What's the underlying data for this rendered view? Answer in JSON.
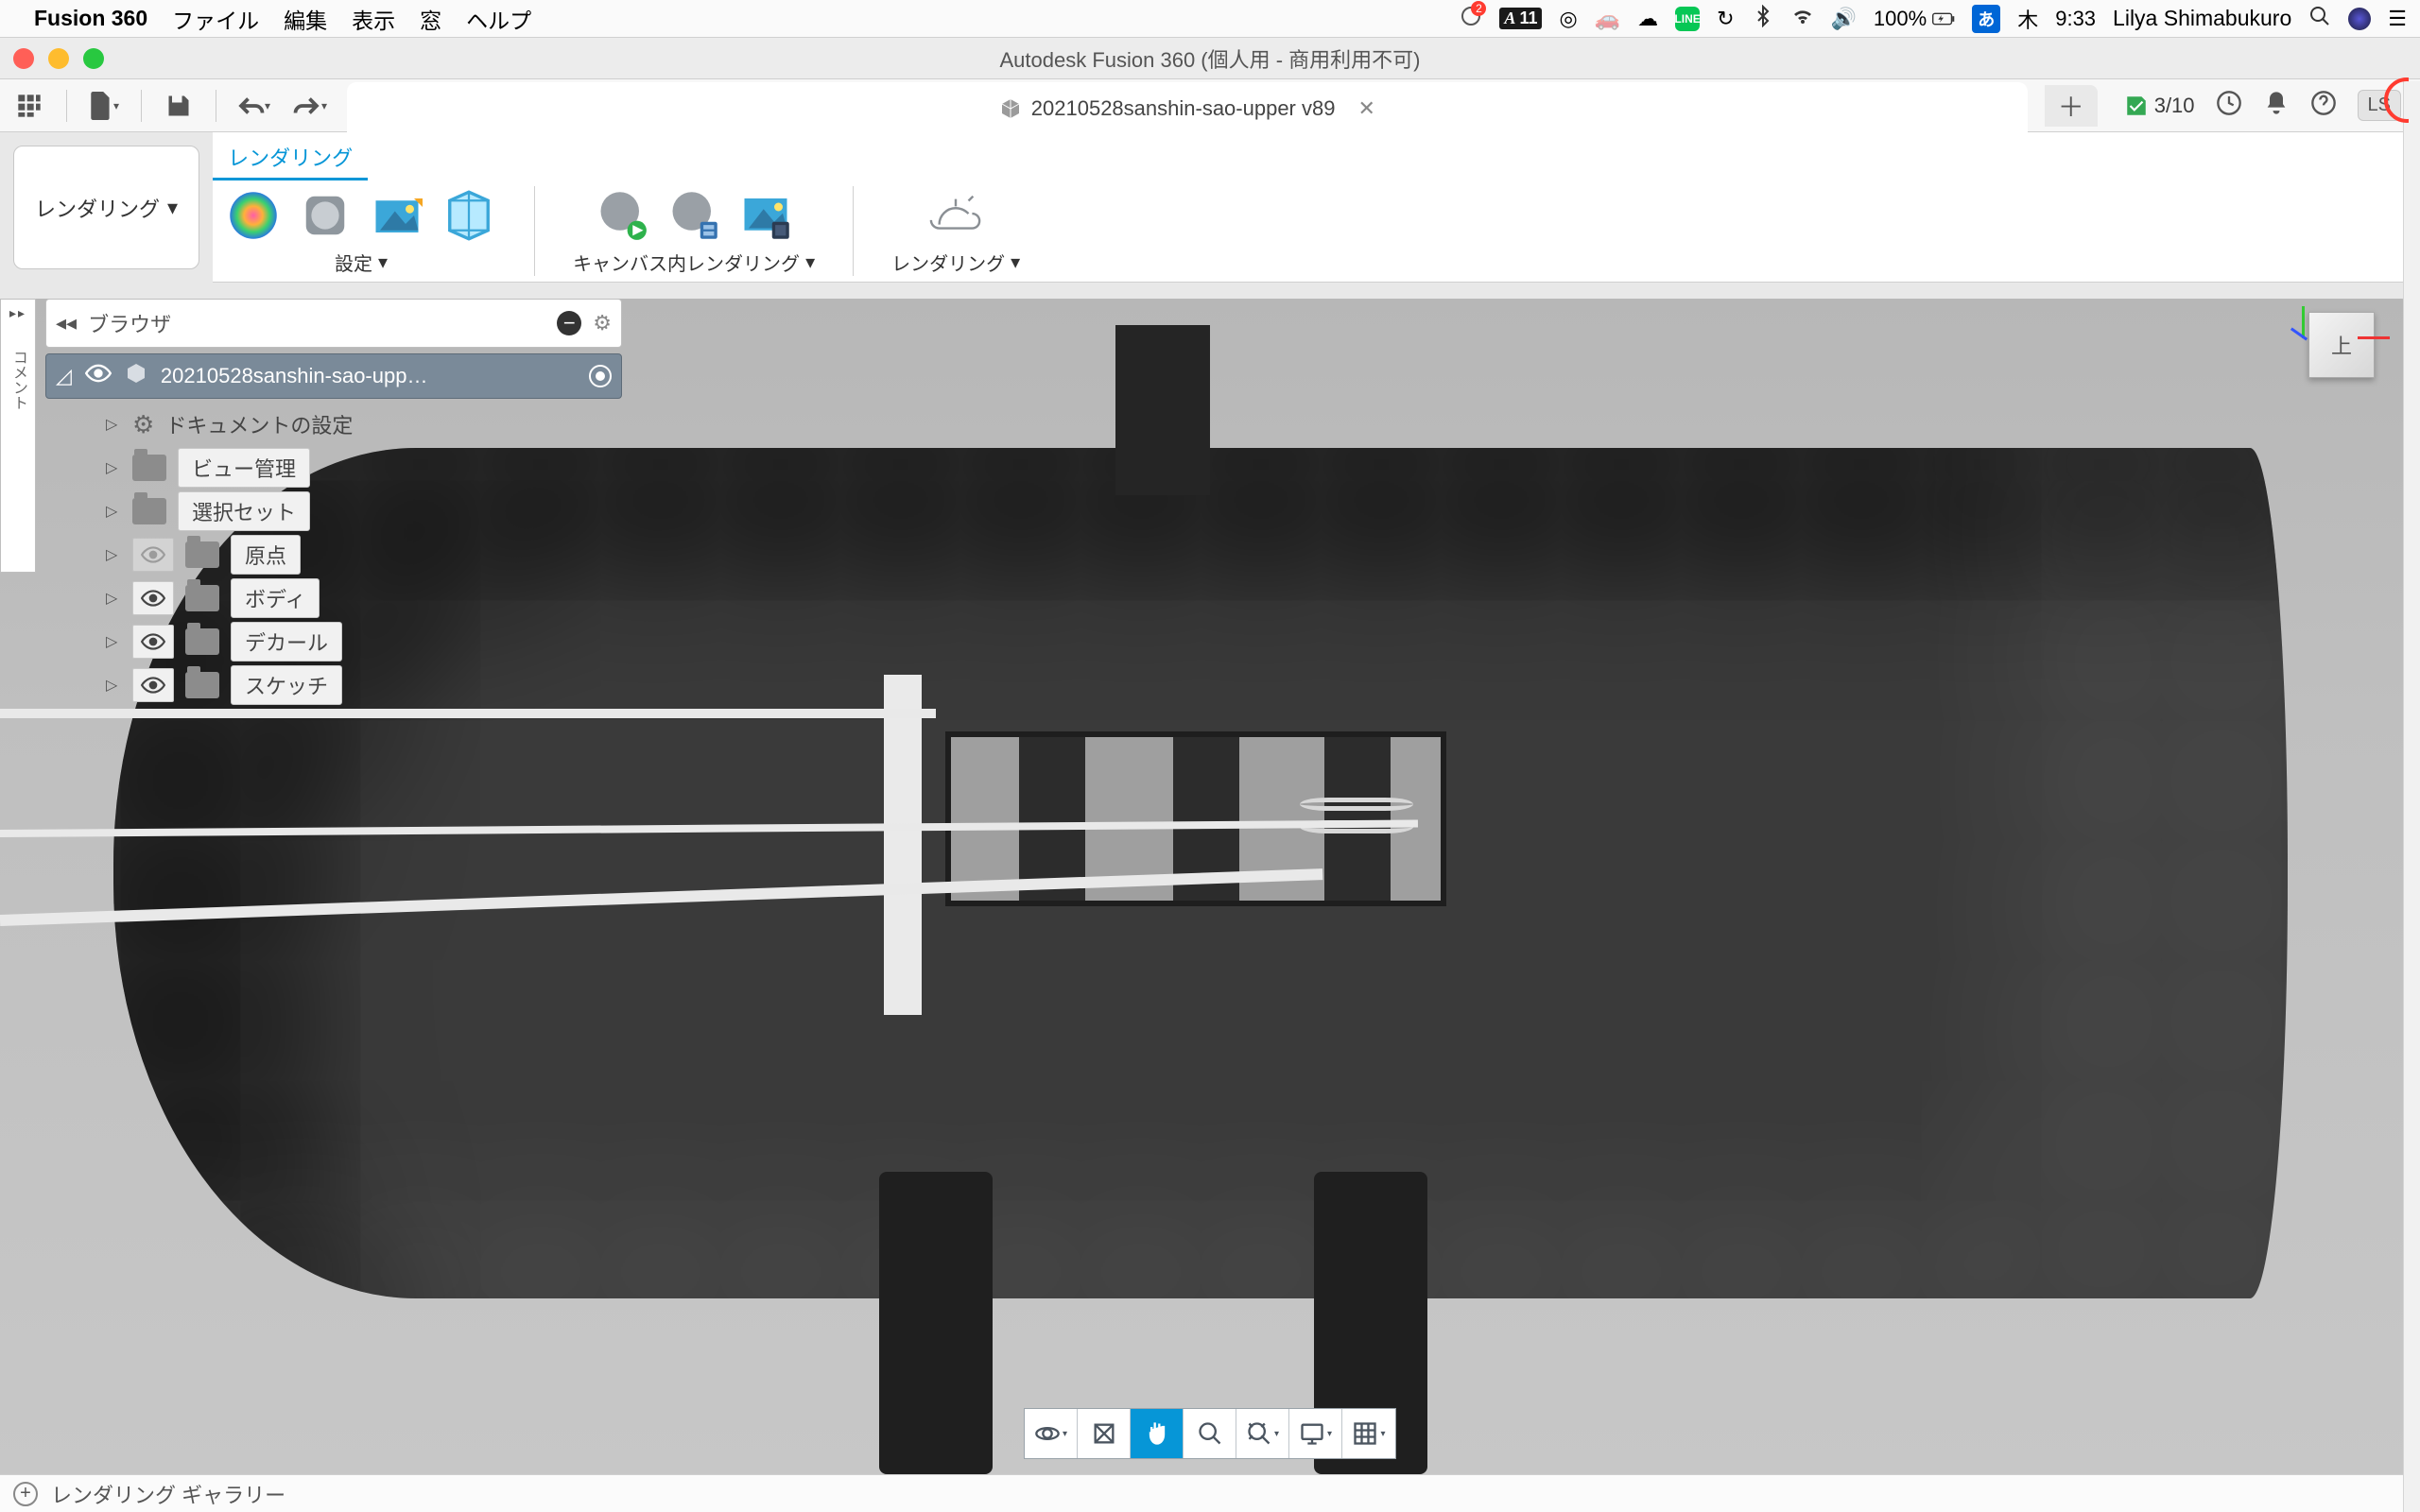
{
  "mac_menu": {
    "app": "Fusion 360",
    "items": [
      "ファイル",
      "編集",
      "表示",
      "窓",
      "ヘルプ"
    ],
    "right": {
      "adobe": "11",
      "battery": "100%",
      "ime": "あ",
      "clock_day": "木",
      "clock_time": "9:33",
      "username": "Lilya Shimabukuro"
    }
  },
  "window": {
    "title": "Autodesk Fusion 360 (個人用 - 商用利用不可)"
  },
  "toolbar": {
    "tab_title": "20210528sanshin-sao-upper v89",
    "jobs": "3/10",
    "avatar": "LS"
  },
  "workspace_button": "レンダリング",
  "ribbon": {
    "active_tab": "レンダリング",
    "groups": {
      "setup": "設定",
      "in_canvas": "キャンバス内レンダリング",
      "render": "レンダリング"
    }
  },
  "browser": {
    "header": "ブラウザ",
    "root": "20210528sanshin-sao-upp…",
    "items": [
      {
        "label": "ドキュメントの設定",
        "icon": "gear",
        "eye_dim": false
      },
      {
        "label": "ビュー管理",
        "icon": "folder",
        "eye_dim": false
      },
      {
        "label": "選択セット",
        "icon": "folder",
        "eye_dim": false
      },
      {
        "label": "原点",
        "icon": "folder",
        "eye_dim": true
      },
      {
        "label": "ボディ",
        "icon": "folder",
        "eye_dim": false
      },
      {
        "label": "デカール",
        "icon": "folder",
        "eye_dim": false
      },
      {
        "label": "スケッチ",
        "icon": "folder",
        "eye_dim": false
      }
    ]
  },
  "viewcube": "上",
  "statusbar": {
    "text": "レンダリング ギャラリー"
  },
  "notifications_badge": "2"
}
